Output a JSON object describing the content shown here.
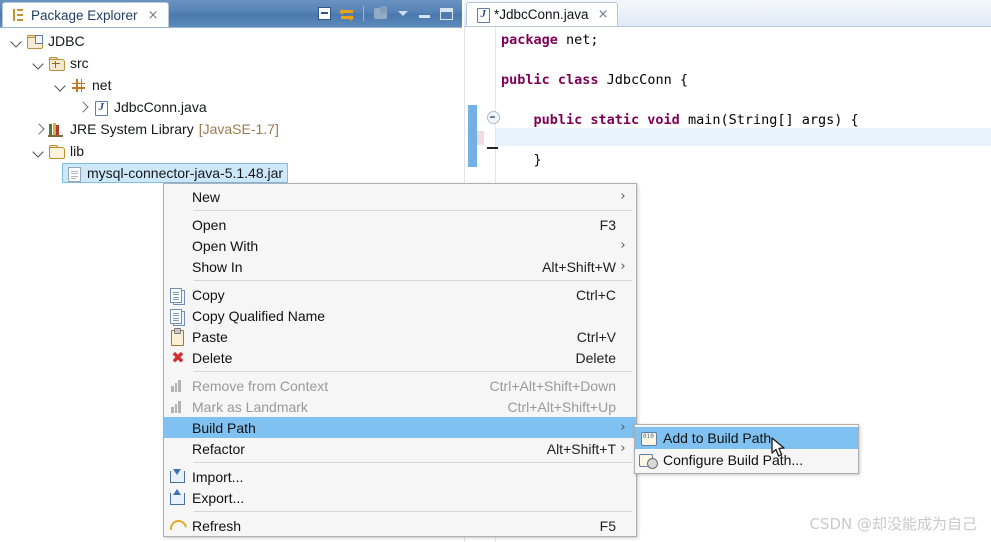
{
  "explorer": {
    "tab": {
      "title": "Package Explorer",
      "close": "×",
      "icon": "package-explorer-icon"
    },
    "toolbar": [
      {
        "name": "collapse-all-icon",
        "tooltip": "Collapse All"
      },
      {
        "name": "link-with-editor-icon",
        "tooltip": "Link with Editor"
      },
      {
        "name": "view-menu-icon",
        "tooltip": "View Menu"
      },
      {
        "name": "chevron-down-icon",
        "tooltip": "Menu"
      },
      {
        "name": "minimize-icon",
        "tooltip": "Minimize"
      },
      {
        "name": "maximize-icon",
        "tooltip": "Maximize"
      }
    ],
    "tree": [
      {
        "label": "JDBC",
        "suffix": "",
        "indent": 0,
        "twisty": "open",
        "icon": "java-project-icon",
        "selected": false
      },
      {
        "label": "src",
        "suffix": "",
        "indent": 1,
        "twisty": "open",
        "icon": "source-folder-icon",
        "selected": false
      },
      {
        "label": "net",
        "suffix": "",
        "indent": 2,
        "twisty": "open",
        "icon": "package-icon",
        "selected": false
      },
      {
        "label": "JdbcConn.java",
        "suffix": "",
        "indent": 3,
        "twisty": "closed",
        "icon": "java-file-icon",
        "selected": false
      },
      {
        "label": "JRE System Library",
        "suffix": "[JavaSE-1.7]",
        "indent": 1,
        "twisty": "closed",
        "icon": "jre-library-icon",
        "selected": false
      },
      {
        "label": "lib",
        "suffix": "",
        "indent": 1,
        "twisty": "open",
        "icon": "folder-icon",
        "selected": false
      },
      {
        "label": "mysql-connector-java-5.1.48.jar",
        "suffix": "",
        "indent": 2,
        "twisty": "none",
        "icon": "jar-file-icon",
        "selected": true
      }
    ]
  },
  "editor": {
    "tab": {
      "title": "*JdbcConn.java",
      "close": "×",
      "icon": "java-file-icon"
    },
    "code_lines": [
      {
        "parts": [
          {
            "t": "package",
            "c": "kw"
          },
          {
            "t": " net;",
            "c": "pl"
          }
        ]
      },
      {
        "parts": [
          {
            "t": "",
            "c": "pl"
          }
        ]
      },
      {
        "parts": [
          {
            "t": "public class",
            "c": "kw"
          },
          {
            "t": " JdbcConn {",
            "c": "pl"
          }
        ]
      },
      {
        "parts": [
          {
            "t": "",
            "c": "pl"
          }
        ]
      },
      {
        "parts": [
          {
            "t": "    public static void",
            "c": "kw"
          },
          {
            "t": " main(String[] args) {",
            "c": "pl"
          }
        ]
      },
      {
        "parts": [
          {
            "t": "",
            "c": "pl"
          }
        ]
      },
      {
        "parts": [
          {
            "t": "    }",
            "c": "pl"
          }
        ]
      }
    ]
  },
  "context_menu": {
    "items": [
      {
        "label": "New",
        "accel": "",
        "icon": "",
        "arrow": true,
        "sep_after": true,
        "disabled": false,
        "highlight": false
      },
      {
        "label": "Open",
        "accel": "F3",
        "icon": "",
        "arrow": false,
        "sep_after": false,
        "disabled": false,
        "highlight": false
      },
      {
        "label": "Open With",
        "accel": "",
        "icon": "",
        "arrow": true,
        "sep_after": false,
        "disabled": false,
        "highlight": false
      },
      {
        "label": "Show In",
        "accel": "Alt+Shift+W",
        "icon": "",
        "arrow": true,
        "sep_after": true,
        "disabled": false,
        "highlight": false
      },
      {
        "label": "Copy",
        "accel": "Ctrl+C",
        "icon": "copy-icon",
        "arrow": false,
        "sep_after": false,
        "disabled": false,
        "highlight": false
      },
      {
        "label": "Copy Qualified Name",
        "accel": "",
        "icon": "copy-qualified-icon",
        "arrow": false,
        "sep_after": false,
        "disabled": false,
        "highlight": false
      },
      {
        "label": "Paste",
        "accel": "Ctrl+V",
        "icon": "paste-icon",
        "arrow": false,
        "sep_after": false,
        "disabled": false,
        "highlight": false
      },
      {
        "label": "Delete",
        "accel": "Delete",
        "icon": "delete-icon",
        "arrow": false,
        "sep_after": true,
        "disabled": false,
        "highlight": false
      },
      {
        "label": "Remove from Context",
        "accel": "Ctrl+Alt+Shift+Down",
        "icon": "remove-context-icon",
        "arrow": false,
        "sep_after": false,
        "disabled": true,
        "highlight": false
      },
      {
        "label": "Mark as Landmark",
        "accel": "Ctrl+Alt+Shift+Up",
        "icon": "landmark-icon",
        "arrow": false,
        "sep_after": false,
        "disabled": true,
        "highlight": false
      },
      {
        "label": "Build Path",
        "accel": "",
        "icon": "",
        "arrow": true,
        "sep_after": false,
        "disabled": false,
        "highlight": true
      },
      {
        "label": "Refactor",
        "accel": "Alt+Shift+T",
        "icon": "",
        "arrow": true,
        "sep_after": true,
        "disabled": false,
        "highlight": false
      },
      {
        "label": "Import...",
        "accel": "",
        "icon": "import-icon",
        "arrow": false,
        "sep_after": false,
        "disabled": false,
        "highlight": false
      },
      {
        "label": "Export...",
        "accel": "",
        "icon": "export-icon",
        "arrow": false,
        "sep_after": true,
        "disabled": false,
        "highlight": false
      },
      {
        "label": "Refresh",
        "accel": "F5",
        "icon": "refresh-icon",
        "arrow": false,
        "sep_after": false,
        "disabled": false,
        "highlight": false
      }
    ]
  },
  "submenu": {
    "items": [
      {
        "label": "Add to Build Path",
        "icon": "add-to-build-path-icon",
        "highlight": true
      },
      {
        "label": "Configure Build Path...",
        "icon": "configure-build-path-icon",
        "highlight": false
      }
    ]
  },
  "watermark": {
    "text": "CSDN @却没能成为自己"
  },
  "colors": {
    "menu_highlight": "#7fc1f0",
    "tree_selection": "#cde8f9",
    "tab_active_border": "#b6c7d8",
    "keyword": "#7f0055",
    "view_tab_gradient": "#5481b4",
    "current_line": "#e8f2fc",
    "change_bar": "#5aa3e0"
  }
}
